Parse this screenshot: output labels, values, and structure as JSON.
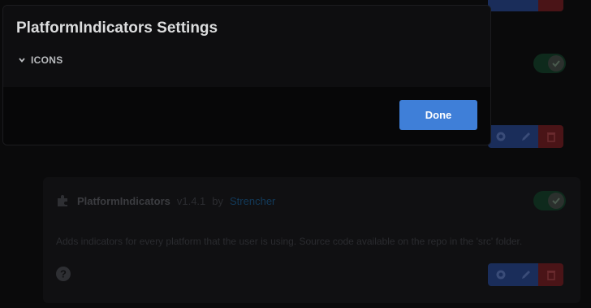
{
  "modal": {
    "title": "PlatformIndicators Settings",
    "section_label": "ICONS",
    "done_label": "Done"
  },
  "plugin": {
    "name": "PlatformIndicators",
    "version": "v1.4.1",
    "by": "by",
    "author": "Strencher",
    "description": "Adds indicators for every platform that the user is using. Source code available on the repo in the 'src' folder."
  },
  "colors": {
    "accent": "#3f7fd8",
    "toggle_on": "#3ba55c",
    "danger": "#ed4245"
  }
}
